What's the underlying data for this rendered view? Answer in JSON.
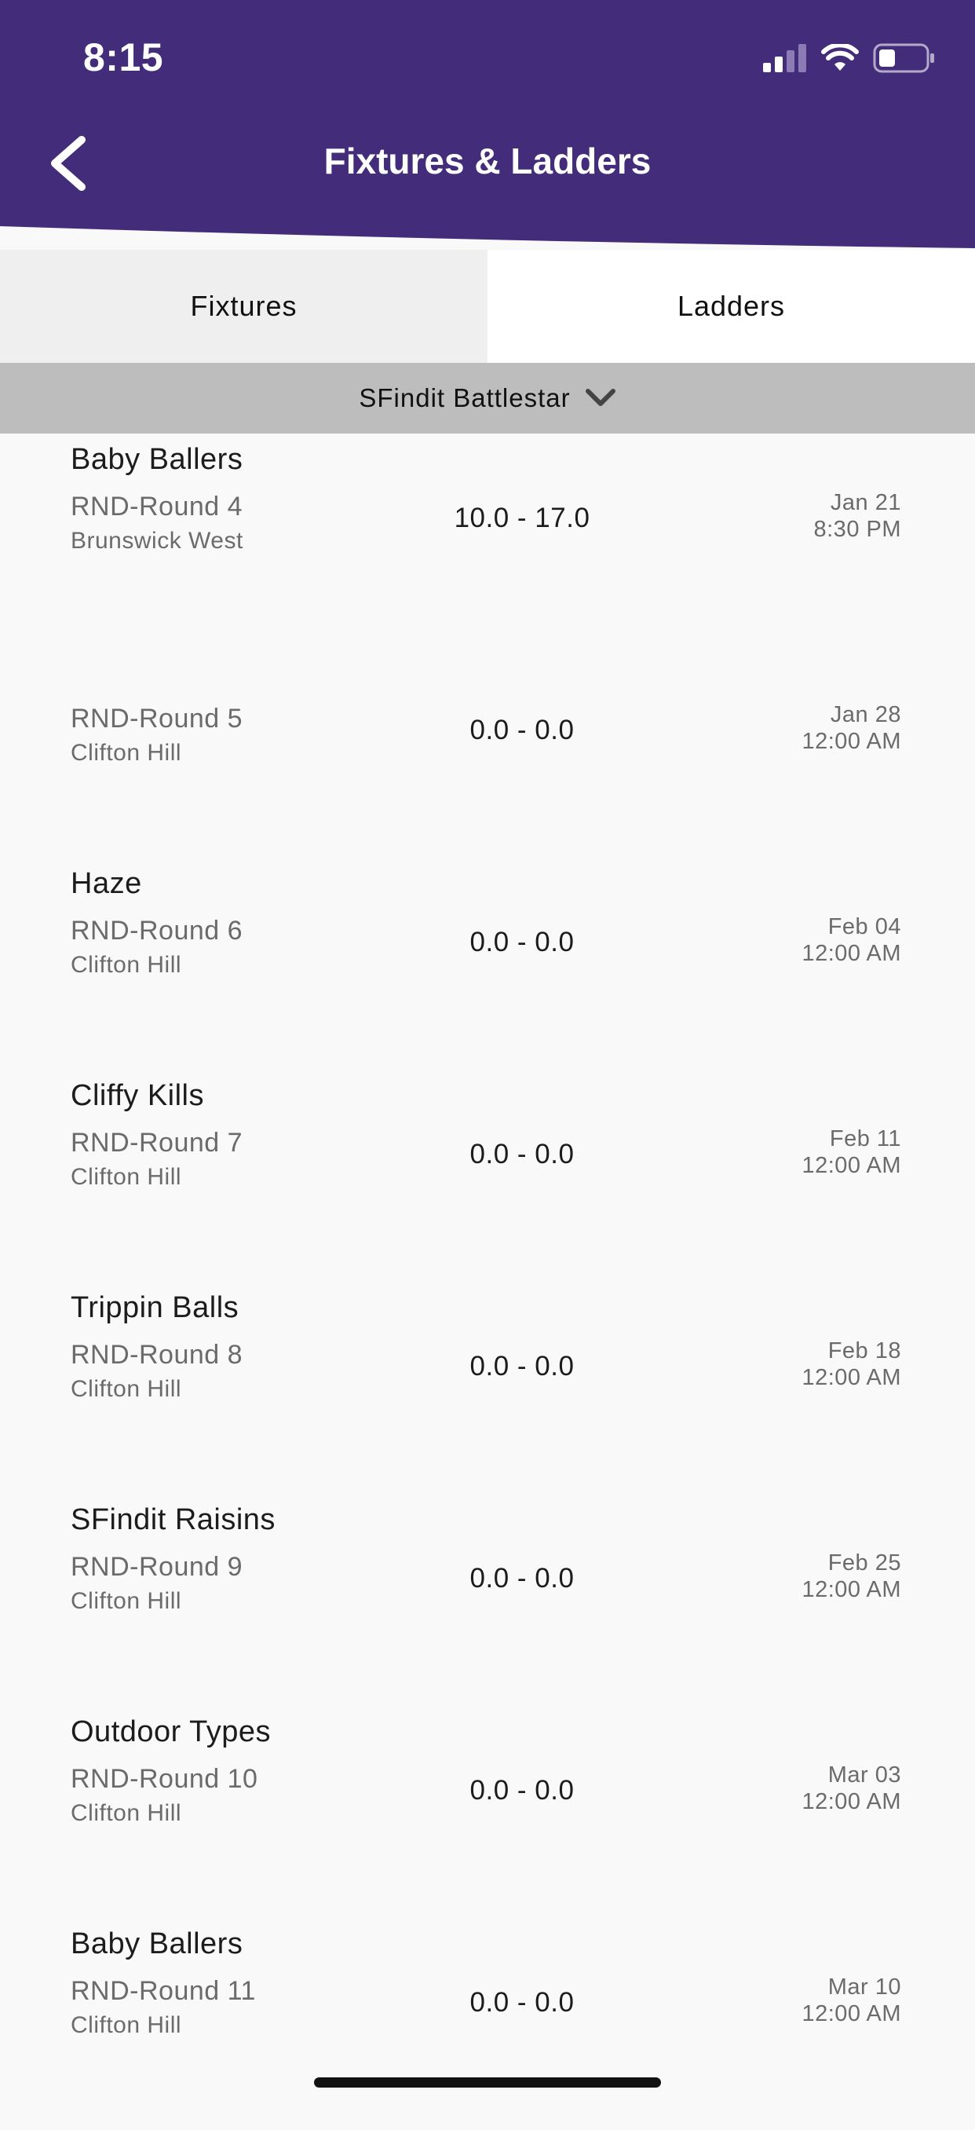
{
  "status_bar": {
    "time": "8:15"
  },
  "header": {
    "title": "Fixtures & Ladders",
    "back_icon": "chevron-left-icon",
    "color": "#432c7a"
  },
  "tabs": [
    {
      "label": "Fixtures",
      "active": false
    },
    {
      "label": "Ladders",
      "active": true
    }
  ],
  "team_selector": {
    "selected": "SFindit Battlestar",
    "icon": "chevron-down-icon"
  },
  "fixtures": [
    {
      "opponent": "Baby Ballers",
      "round": "RND-Round 4",
      "venue": "Brunswick West",
      "score": "10.0 - 17.0",
      "date": "Jan 21",
      "time": "8:30 PM"
    },
    {
      "opponent": "",
      "round": "RND-Round 5",
      "venue": "Clifton Hill",
      "score": "0.0 - 0.0",
      "date": "Jan 28",
      "time": "12:00 AM"
    },
    {
      "opponent": "Haze",
      "round": "RND-Round 6",
      "venue": "Clifton Hill",
      "score": "0.0 - 0.0",
      "date": "Feb 04",
      "time": "12:00 AM"
    },
    {
      "opponent": "Cliffy Kills",
      "round": "RND-Round 7",
      "venue": "Clifton Hill",
      "score": "0.0 - 0.0",
      "date": "Feb 11",
      "time": "12:00 AM"
    },
    {
      "opponent": "Trippin Balls",
      "round": "RND-Round 8",
      "venue": "Clifton Hill",
      "score": "0.0 - 0.0",
      "date": "Feb 18",
      "time": "12:00 AM"
    },
    {
      "opponent": "SFindit Raisins",
      "round": "RND-Round 9",
      "venue": "Clifton Hill",
      "score": "0.0 - 0.0",
      "date": "Feb 25",
      "time": "12:00 AM"
    },
    {
      "opponent": "Outdoor Types",
      "round": "RND-Round 10",
      "venue": "Clifton Hill",
      "score": "0.0 - 0.0",
      "date": "Mar 03",
      "time": "12:00 AM"
    },
    {
      "opponent": "Baby Ballers",
      "round": "RND-Round 11",
      "venue": "Clifton Hill",
      "score": "0.0 - 0.0",
      "date": "Mar 10",
      "time": "12:00 AM"
    }
  ]
}
